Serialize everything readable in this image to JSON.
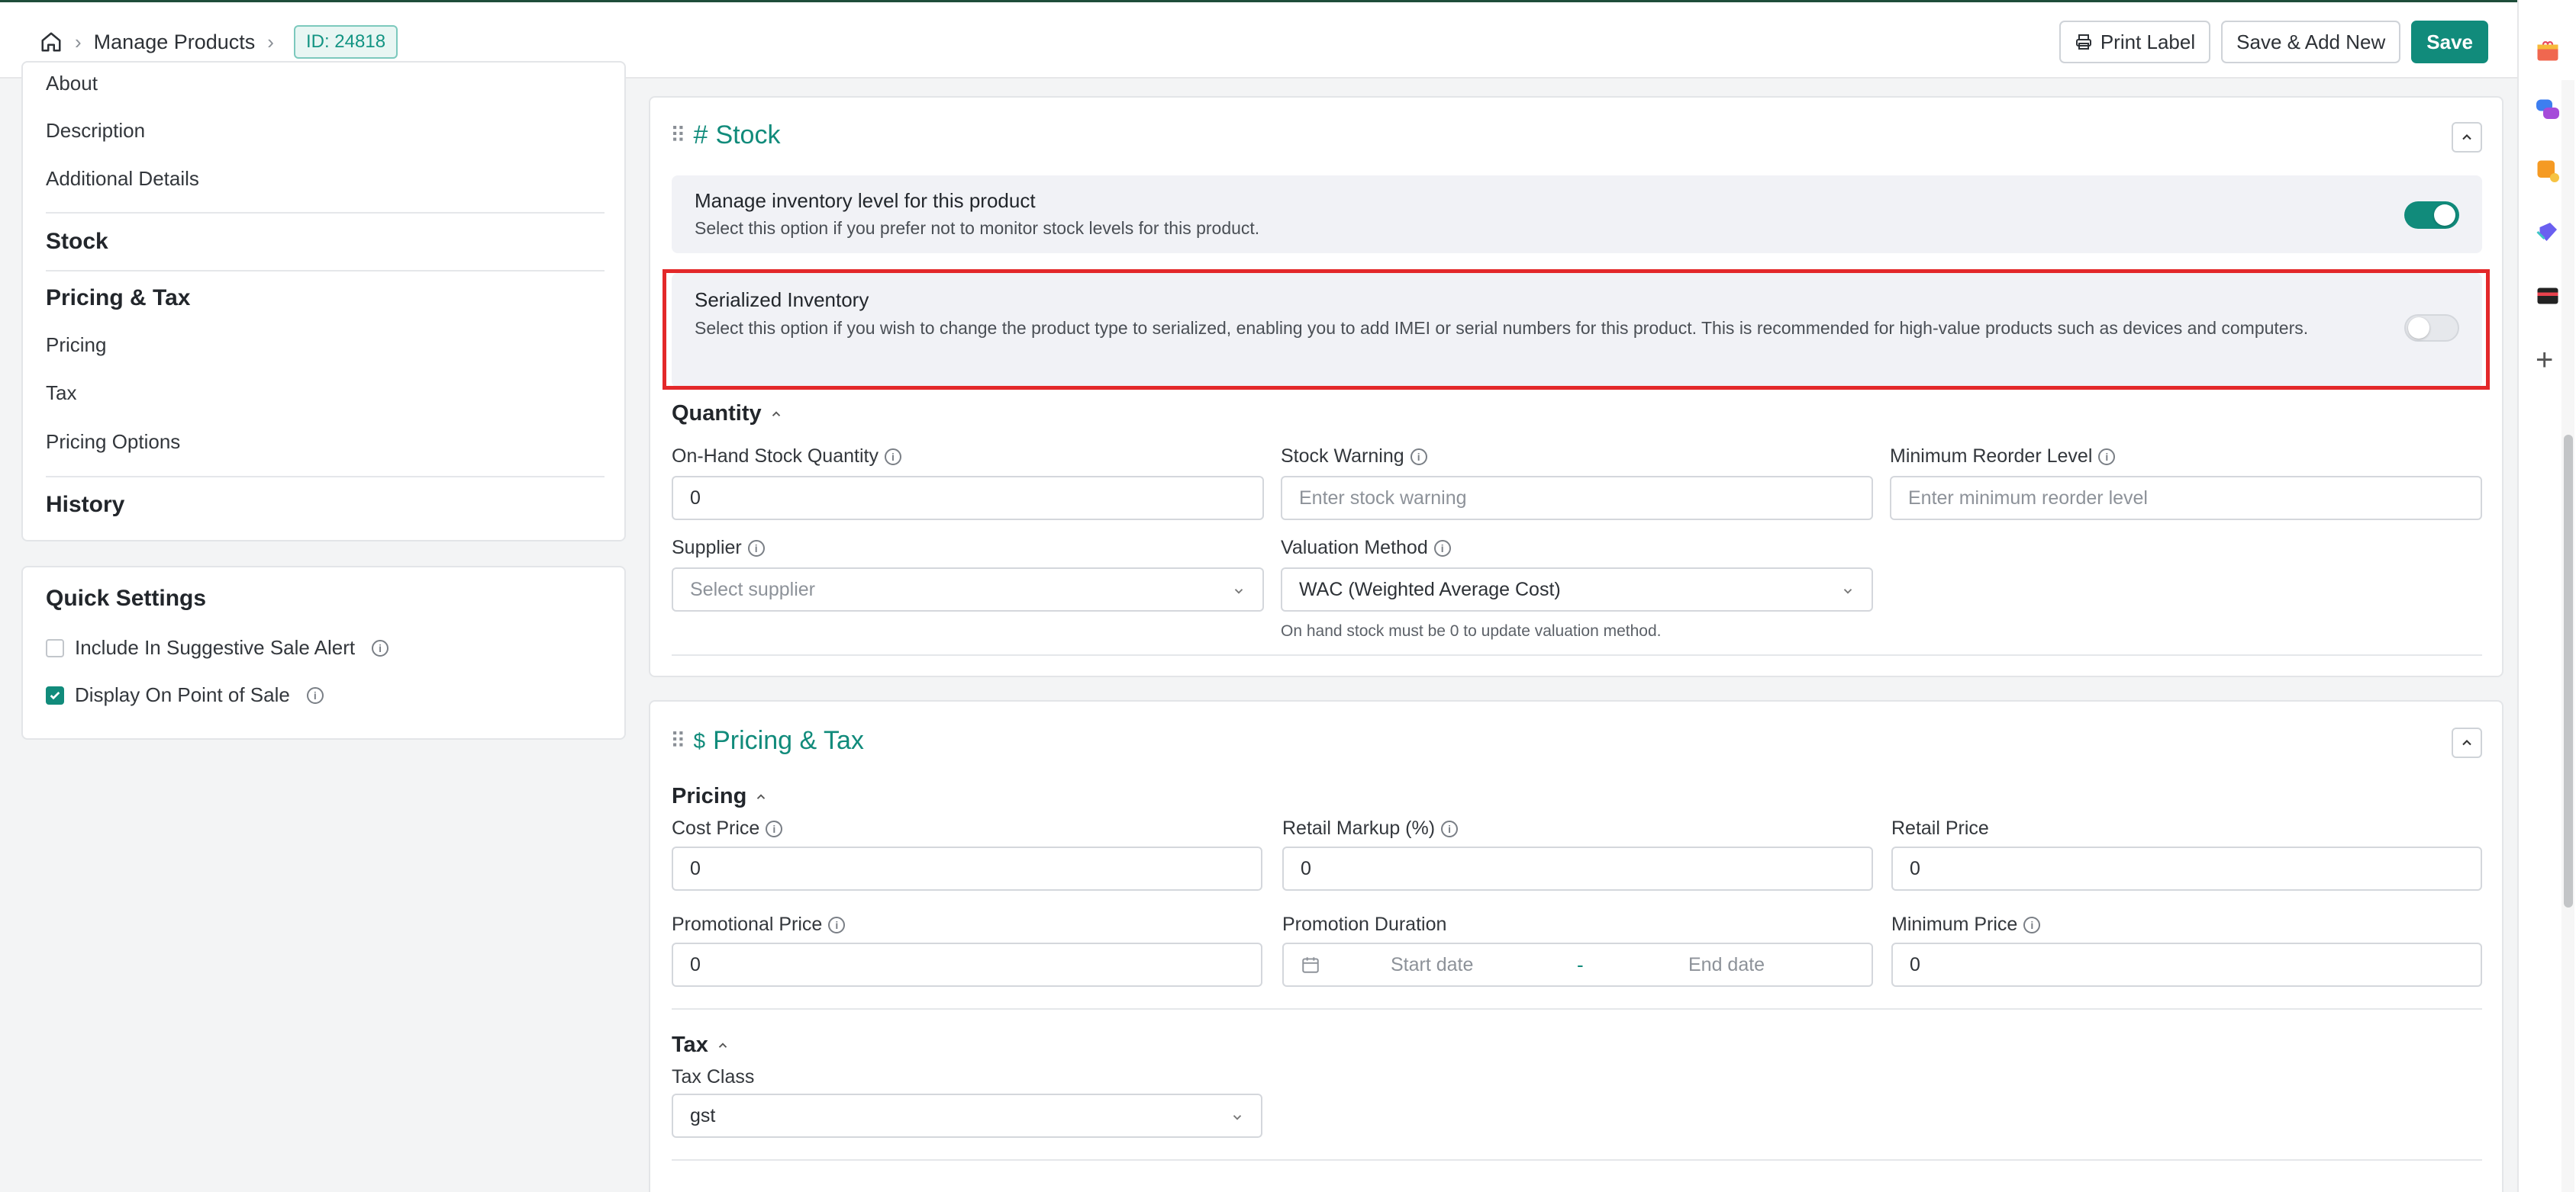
{
  "header": {
    "breadcrumb_page": "Manage Products",
    "product_id": "ID: 24818",
    "print_label": "Print Label",
    "save_add_new": "Save & Add New",
    "save": "Save"
  },
  "nav": {
    "about": "About",
    "description": "Description",
    "additional_details": "Additional Details",
    "stock": "Stock",
    "pricing_tax": "Pricing & Tax",
    "pricing": "Pricing",
    "tax": "Tax",
    "pricing_options": "Pricing Options",
    "history": "History"
  },
  "quick_settings": {
    "title": "Quick Settings",
    "suggestive_sale": "Include In Suggestive Sale Alert",
    "suggestive_sale_checked": false,
    "display_pos": "Display On Point of Sale",
    "display_pos_checked": true
  },
  "stock": {
    "icon": "#",
    "title": "Stock",
    "manage_inventory": {
      "title": "Manage inventory level for this product",
      "desc": "Select this option if you prefer not to monitor stock levels for this product.",
      "enabled": true
    },
    "serialized": {
      "title": "Serialized Inventory",
      "desc": "Select this option if you wish to change the product type to serialized, enabling you to add IMEI or serial numbers for this product. This is recommended for high-value products such as devices and computers.",
      "enabled": false
    },
    "quantity_heading": "Quantity",
    "on_hand_label": "On-Hand Stock Quantity",
    "on_hand_value": "0",
    "stock_warning_label": "Stock Warning",
    "stock_warning_placeholder": "Enter stock warning",
    "min_reorder_label": "Minimum Reorder Level",
    "min_reorder_placeholder": "Enter minimum reorder level",
    "supplier_label": "Supplier",
    "supplier_placeholder": "Select supplier",
    "valuation_label": "Valuation Method",
    "valuation_value": "WAC (Weighted Average Cost)",
    "valuation_hint": "On hand stock must be 0 to update valuation method."
  },
  "pricing_tax": {
    "icon": "$",
    "title": "Pricing & Tax",
    "pricing_heading": "Pricing",
    "cost_price_label": "Cost Price",
    "cost_price_value": "0",
    "retail_markup_label": "Retail Markup (%)",
    "retail_markup_value": "0",
    "retail_price_label": "Retail Price",
    "retail_price_value": "0",
    "promo_price_label": "Promotional Price",
    "promo_price_value": "0",
    "promo_duration_label": "Promotion Duration",
    "start_date_placeholder": "Start date",
    "end_date_placeholder": "End date",
    "date_separator": "-",
    "min_price_label": "Minimum Price",
    "min_price_value": "0",
    "tax_heading": "Tax",
    "tax_class_label": "Tax Class",
    "tax_class_value": "gst"
  },
  "colors": {
    "accent": "#118b7b",
    "highlight": "#e3282a"
  }
}
